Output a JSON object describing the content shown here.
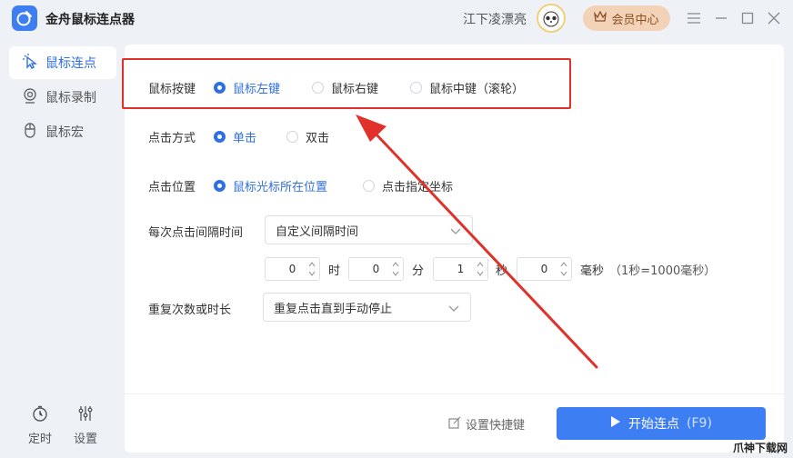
{
  "app": {
    "title": "金舟鼠标连点器"
  },
  "account": {
    "user_name": "江下凌漂亮",
    "vip_label": "会员中心"
  },
  "sidebar": {
    "items": [
      {
        "label": "鼠标连点",
        "active": true
      },
      {
        "label": "鼠标录制",
        "active": false
      },
      {
        "label": "鼠标宏",
        "active": false
      }
    ],
    "bottom": {
      "timer_label": "定时",
      "settings_label": "设置"
    }
  },
  "form": {
    "mouse_button": {
      "label": "鼠标按键",
      "options": [
        "鼠标左键",
        "鼠标右键",
        "鼠标中键（滚轮）"
      ],
      "selected": "鼠标左键"
    },
    "click_mode": {
      "label": "点击方式",
      "options": [
        "单击",
        "双击"
      ],
      "selected": "单击"
    },
    "click_position": {
      "label": "点击位置",
      "options": [
        "鼠标光标所在位置",
        "点击指定坐标"
      ],
      "selected": "鼠标光标所在位置"
    },
    "interval": {
      "label": "每次点击间隔时间",
      "mode_value": "自定义间隔时间",
      "hours": "0",
      "hours_unit": "时",
      "minutes": "0",
      "minutes_unit": "分",
      "seconds": "1",
      "seconds_unit": "秒",
      "ms": "0",
      "ms_unit": "毫秒",
      "hint": "（1秒=1000毫秒）"
    },
    "repeat": {
      "label": "重复次数或时长",
      "value": "重复点击直到手动停止"
    }
  },
  "footer": {
    "shortcut_label": "设置快捷键",
    "start_label": "开始连点",
    "start_key": "(F9)"
  },
  "watermark": "爪神下载网",
  "colors": {
    "accent": "#3d7ef3",
    "highlight": "#e0312b",
    "vip_bg": "#f3d3b7"
  }
}
